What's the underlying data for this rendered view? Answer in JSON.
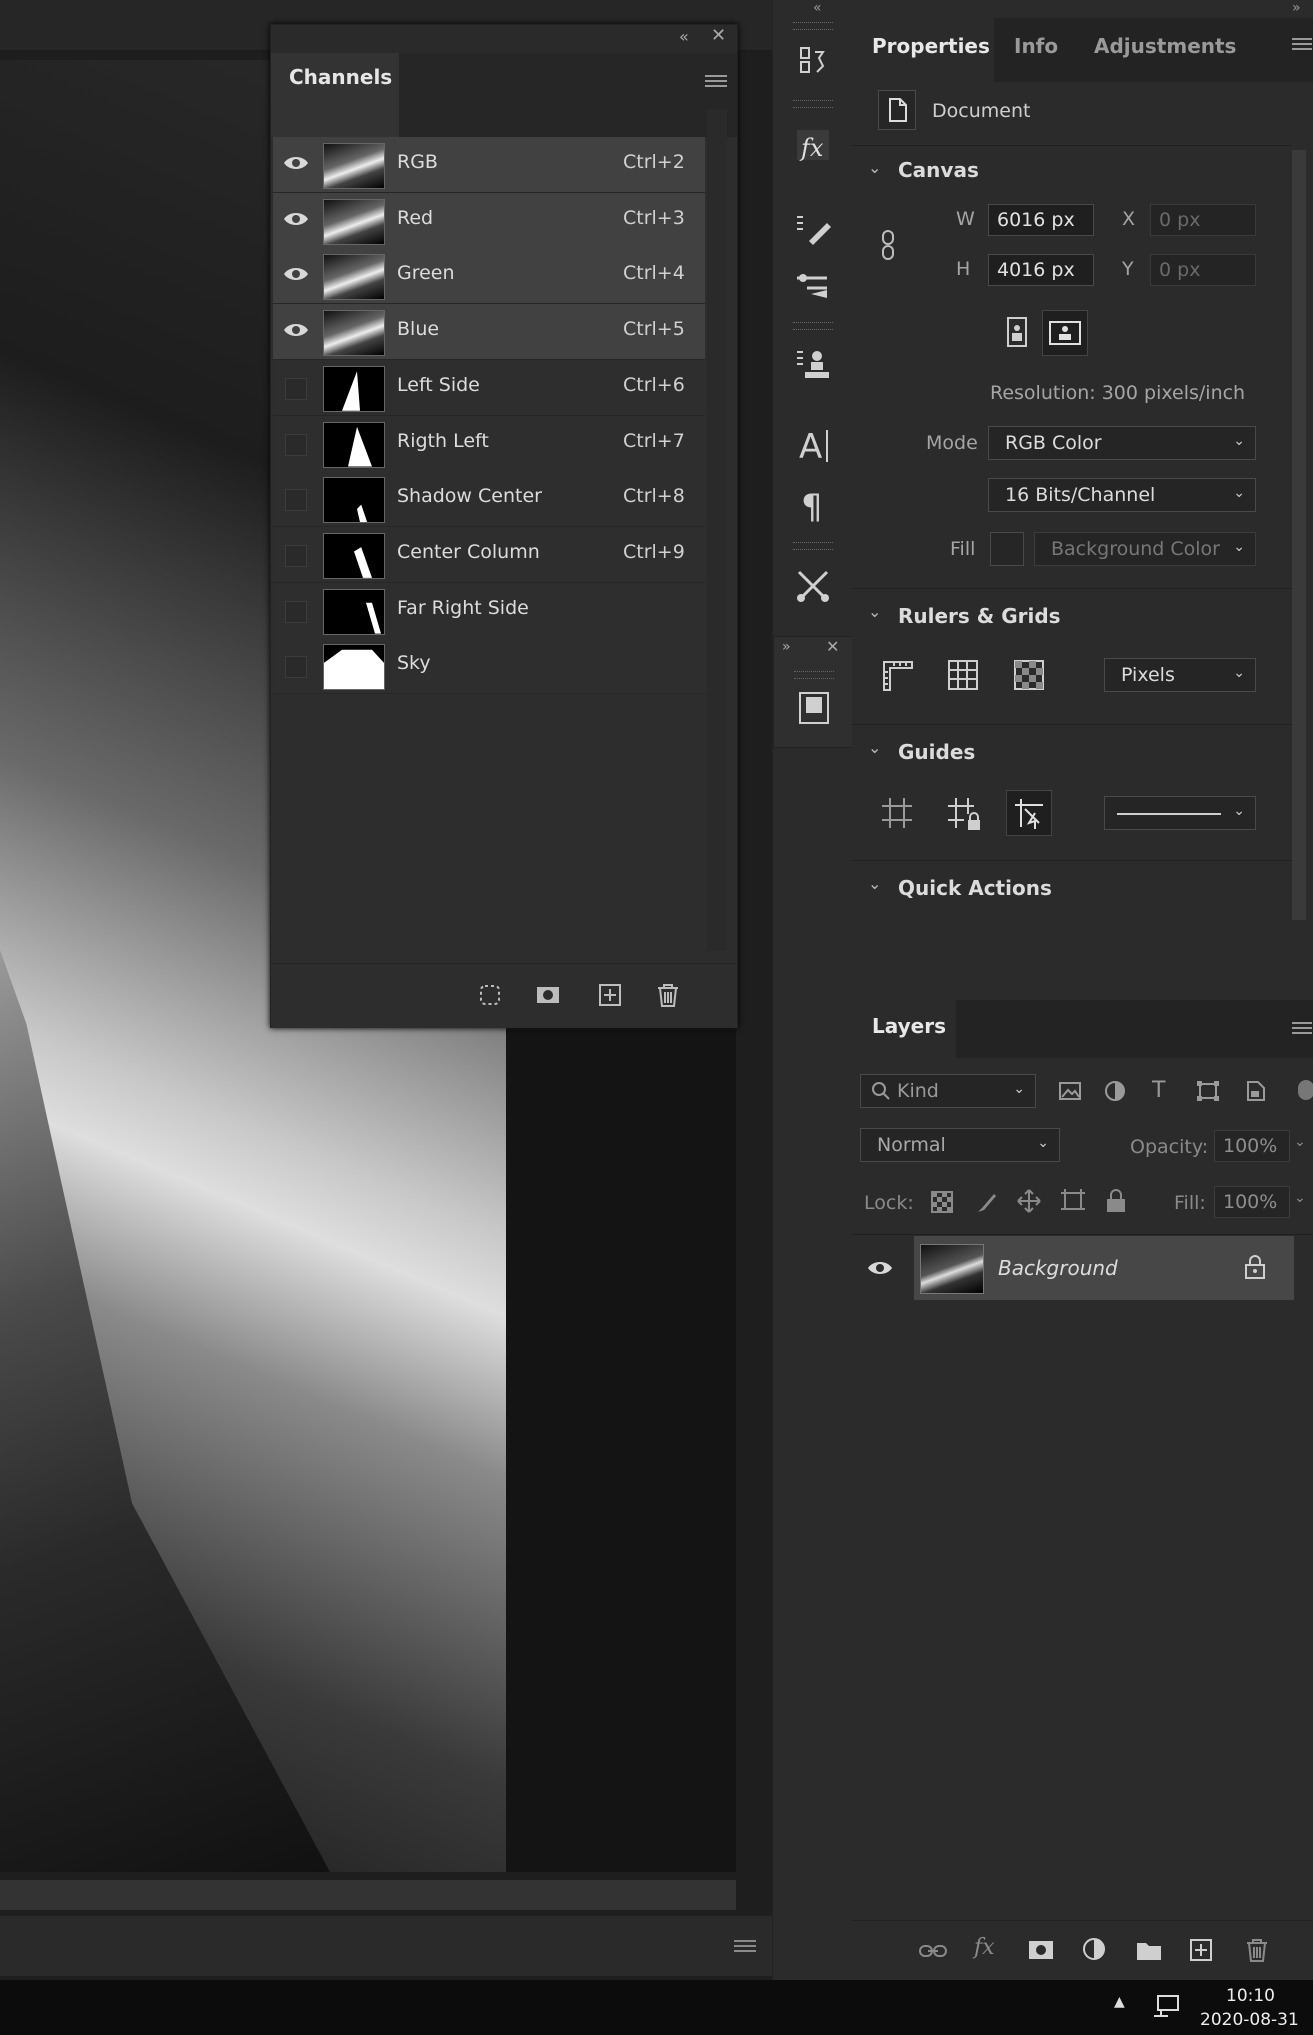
{
  "channels_panel": {
    "title": "Channels",
    "rows": [
      {
        "name": "RGB",
        "shortcut": "Ctrl+2",
        "visible": true
      },
      {
        "name": "Red",
        "shortcut": "Ctrl+3",
        "visible": true
      },
      {
        "name": "Green",
        "shortcut": "Ctrl+4",
        "visible": true
      },
      {
        "name": "Blue",
        "shortcut": "Ctrl+5",
        "visible": true
      },
      {
        "name": "Left Side",
        "shortcut": "Ctrl+6",
        "visible": false
      },
      {
        "name": "Rigth Left",
        "shortcut": "Ctrl+7",
        "visible": false
      },
      {
        "name": "Shadow Center",
        "shortcut": "Ctrl+8",
        "visible": false
      },
      {
        "name": "Center Column",
        "shortcut": "Ctrl+9",
        "visible": false
      },
      {
        "name": "Far Right Side",
        "shortcut": "",
        "visible": false
      },
      {
        "name": "Sky",
        "shortcut": "",
        "visible": false
      }
    ],
    "footer_icons": [
      "load-selection-icon",
      "save-selection-icon",
      "new-channel-icon",
      "delete-channel-icon"
    ]
  },
  "properties_panel": {
    "tabs": [
      "Properties",
      "Info",
      "Adjustments"
    ],
    "document_label": "Document",
    "canvas": {
      "title": "Canvas",
      "w_label": "W",
      "w_value": "6016 px",
      "h_label": "H",
      "h_value": "4016 px",
      "x_label": "X",
      "x_value": "0 px",
      "y_label": "Y",
      "y_value": "0 px",
      "resolution": "Resolution: 300 pixels/inch",
      "mode_label": "Mode",
      "mode_value": "RGB Color",
      "bits_value": "16 Bits/Channel",
      "fill_label": "Fill",
      "fill_value": "Background Color"
    },
    "rulers_grids": {
      "title": "Rulers & Grids",
      "units_value": "Pixels"
    },
    "guides": {
      "title": "Guides"
    },
    "quick_actions": {
      "title": "Quick Actions"
    }
  },
  "layers_panel": {
    "title": "Layers",
    "kind_placeholder": "Kind",
    "blend_mode": "Normal",
    "opacity_label": "Opacity:",
    "opacity_value": "100%",
    "lock_label": "Lock:",
    "fill_label": "Fill:",
    "fill_value": "100%",
    "layers": [
      {
        "name": "Background",
        "visible": true,
        "locked": true
      }
    ]
  },
  "taskbar": {
    "time": "10:10",
    "date": "2020-08-31"
  },
  "colors": {
    "panel_bg": "#2b2b2b",
    "row_visible": "#414141",
    "canvas_bg": "#1e1e1e"
  }
}
